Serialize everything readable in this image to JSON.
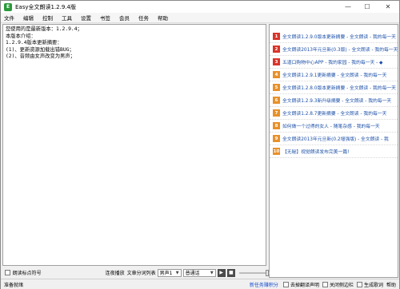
{
  "window": {
    "title": "Easy全文朗读1.2.9.4版",
    "icon_glyph": "E",
    "controls": {
      "minimize": "—",
      "maximize": "☐",
      "close": "✕"
    }
  },
  "menu": [
    "文件",
    "编辑",
    "控制",
    "工具",
    "设置",
    "书签",
    "会员",
    "任务",
    "帮助"
  ],
  "editor": {
    "lines": [
      "您使用的是最新版本：1.2.9.4；",
      "本版本介绍：",
      "1.2.9.4版本更新摘要：",
      "(1)、更新资源加载出错BUG；",
      "(2)、音频由女声改变为男声；"
    ]
  },
  "sidebar": {
    "items": [
      {
        "num": "1",
        "text": "全文朗读1.2.9.0版本更新摘要 - 全文朗读 - 我的每一天",
        "color": "#d9342b"
      },
      {
        "num": "2",
        "text": "全文朗读2013年元旦新(0.3版) - 全文朗读 - 我的每一天",
        "color": "#d9342b"
      },
      {
        "num": "3",
        "text": "五道口购物中心APP - 我的家园 - 我的每一天 - ◆",
        "color": "#d9342b"
      },
      {
        "num": "4",
        "text": "全文朗读1.2.9.1更新摘要 - 全文朗读 - 我的每一天",
        "color": "#e8902a"
      },
      {
        "num": "5",
        "text": "全文朗读1.2.8.0版本更新摘要 - 全文朗读 - 我的每一天",
        "color": "#e8902a"
      },
      {
        "num": "6",
        "text": "全文朗读1.2.9.3新升级摘要 - 全文朗读 - 我的每一天",
        "color": "#e8902a"
      },
      {
        "num": "7",
        "text": "全文朗读1.2.8.7更新摘要 - 全文朗读 - 我的每一天",
        "color": "#e8902a"
      },
      {
        "num": "8",
        "text": "如何做一个过得的女人 - 随笔杂感 - 我的每一天",
        "color": "#e8902a"
      },
      {
        "num": "9",
        "text": "全文朗读2013年元旦新(0.2增强版) - 全文朗读 - 我",
        "color": "#e8902a"
      },
      {
        "num": "10",
        "text": "【无秘】视觉朗读发布完美一篇!",
        "color": "#e8902a"
      }
    ]
  },
  "bottom": {
    "read_punct_label": "朗读标点符号",
    "loop_label": "连夜播放",
    "split_label": "文章分词列表",
    "voice_value": "男声1",
    "mode_value": "普通话",
    "play_glyph": "▶",
    "stop_glyph": "■"
  },
  "status": {
    "text": "准备就绪",
    "link": "新任务赚积分",
    "chk1": "去掉翻译声明",
    "chk2": "关闭侧边栏",
    "chk3": "生成歌词",
    "help": "帮助"
  },
  "colors": {
    "accent_link": "#1a4fd0",
    "news_hot": "#d9342b",
    "news_warm": "#e8902a"
  }
}
